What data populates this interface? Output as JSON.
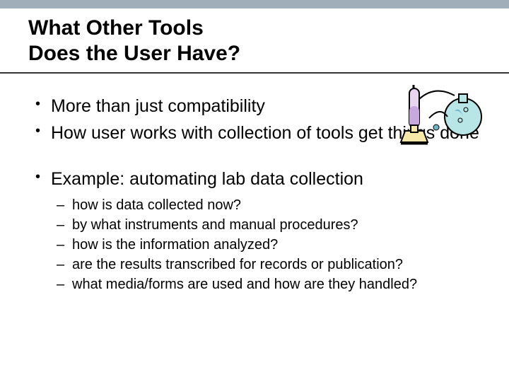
{
  "header": {
    "title_line1": "What Other Tools",
    "title_line2": "Does the User Have?"
  },
  "bullets": {
    "b1": "More than just compatibility",
    "b2": "How user works with collection of tools get things done",
    "b3": "Example: automating lab data collection"
  },
  "subbullets": {
    "s1": "how is data collected now?",
    "s2": "by what instruments and manual procedures?",
    "s3": "how is the information analyzed?",
    "s4": "are the results transcribed for records or publication?",
    "s5": "what media/forms are used and how are they handled?"
  },
  "illustration": {
    "name": "lab-equipment-illustration"
  }
}
